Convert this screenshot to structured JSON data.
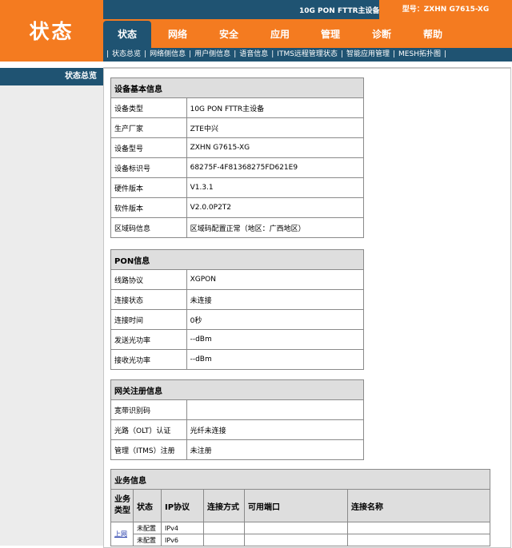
{
  "logo": {
    "title": "状态"
  },
  "header": {
    "device_name": "10G PON FTTR主设备",
    "model": "型号：ZXHN  G7615-XG"
  },
  "tabs": [
    {
      "label": "状态",
      "active": true
    },
    {
      "label": "网络"
    },
    {
      "label": "安全"
    },
    {
      "label": "应用"
    },
    {
      "label": "管理"
    },
    {
      "label": "诊断"
    },
    {
      "label": "帮助"
    }
  ],
  "subnav": [
    "状态总览",
    "网络侧信息",
    "用户侧信息",
    "语音信息",
    "ITMS远程管理状态",
    "智能应用管理",
    "MESH拓扑图"
  ],
  "sidebar": {
    "items": [
      "状态总览"
    ]
  },
  "basic": {
    "title": "设备基本信息",
    "rows": [
      {
        "label": "设备类型",
        "value": "10G PON FTTR主设备"
      },
      {
        "label": "生产厂家",
        "value": "ZTE中兴"
      },
      {
        "label": "设备型号",
        "value": "ZXHN  G7615-XG"
      },
      {
        "label": "设备标识号",
        "value": "68275F-4F81368275FD621E9"
      },
      {
        "label": "硬件版本",
        "value": "V1.3.1"
      },
      {
        "label": "软件版本",
        "value": "V2.0.0P2T2"
      },
      {
        "label": "区域码信息",
        "value": "区域码配置正常（地区：广西地区）"
      }
    ]
  },
  "pon": {
    "title": "PON信息",
    "rows": [
      {
        "label": "线路协议",
        "value": "XGPON"
      },
      {
        "label": "连接状态",
        "value": "未连接"
      },
      {
        "label": "连接时间",
        "value": "0秒"
      },
      {
        "label": "发送光功率",
        "value": "--dBm"
      },
      {
        "label": "接收光功率",
        "value": "--dBm"
      }
    ]
  },
  "gateway": {
    "title": "网关注册信息",
    "rows": [
      {
        "label": "宽带识别码",
        "value": ""
      },
      {
        "label": "光路（OLT）认证",
        "value": "光纤未连接"
      },
      {
        "label": "管理（ITMS）注册",
        "value": "未注册"
      }
    ]
  },
  "business": {
    "title": "业务信息",
    "headers": [
      "业务类型",
      "状态",
      "IP协议",
      "连接方式",
      "可用端口",
      "连接名称"
    ],
    "type_link": "上网",
    "rows": [
      {
        "status": "未配置",
        "ip": "IPv4"
      },
      {
        "status": "未配置",
        "ip": "IPv6"
      }
    ]
  }
}
